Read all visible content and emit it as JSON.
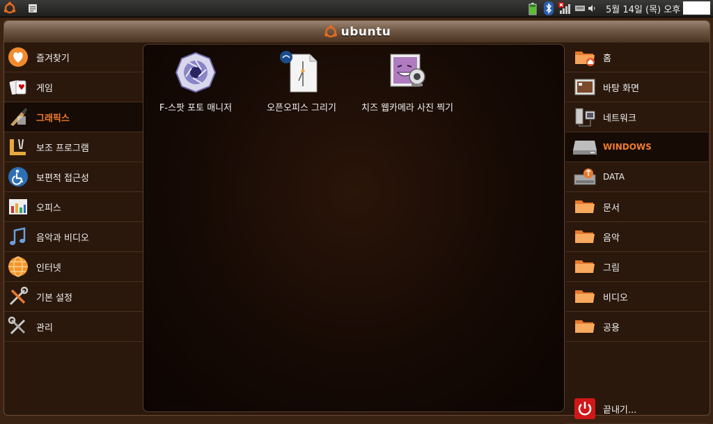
{
  "top_panel": {
    "clock": "5월 14일 (목) 오후",
    "icons": [
      "ubuntu-logo-icon",
      "accessories-icon",
      "battery-icon",
      "bluetooth-icon",
      "network-disconnected-icon",
      "keyboard-icon",
      "signal-icon",
      "volume-icon"
    ]
  },
  "title": {
    "logo_text": "ubuntu"
  },
  "categories": [
    {
      "label": "즐겨찾기",
      "icon": "favorites-heart-icon"
    },
    {
      "label": "게임",
      "icon": "games-cards-icon"
    },
    {
      "label": "그래픽스",
      "icon": "graphics-brush-icon",
      "selected": true
    },
    {
      "label": "보조 프로그램",
      "icon": "accessories-tools-icon"
    },
    {
      "label": "보편적 접근성",
      "icon": "accessibility-icon"
    },
    {
      "label": "오피스",
      "icon": "office-chart-icon"
    },
    {
      "label": "음악과 비디오",
      "icon": "music-video-icon"
    },
    {
      "label": "인터넷",
      "icon": "internet-globe-icon"
    },
    {
      "label": "기본 설정",
      "icon": "preferences-icon"
    },
    {
      "label": "관리",
      "icon": "administration-icon"
    }
  ],
  "apps": [
    {
      "label": "F-스팟 포토 매니저",
      "icon": "f-spot-icon"
    },
    {
      "label": "오픈오피스 그리기",
      "icon": "openoffice-draw-icon"
    },
    {
      "label": "치즈 웹카메라 사진 찍기",
      "icon": "cheese-webcam-icon"
    }
  ],
  "places": [
    {
      "label": "홈",
      "icon": "home-folder-icon"
    },
    {
      "label": "바탕 화면",
      "icon": "desktop-icon"
    },
    {
      "label": "네트워크",
      "icon": "network-icon"
    },
    {
      "label": "WINDOWS",
      "icon": "drive-icon",
      "selected": true
    },
    {
      "label": "DATA",
      "icon": "usb-drive-icon"
    },
    {
      "label": "문서",
      "icon": "folder-icon"
    },
    {
      "label": "음악",
      "icon": "folder-icon"
    },
    {
      "label": "그림",
      "icon": "folder-icon"
    },
    {
      "label": "비디오",
      "icon": "folder-icon"
    },
    {
      "label": "공용",
      "icon": "folder-icon"
    }
  ],
  "shutdown": {
    "label": "끝내기...",
    "icon": "power-icon"
  }
}
